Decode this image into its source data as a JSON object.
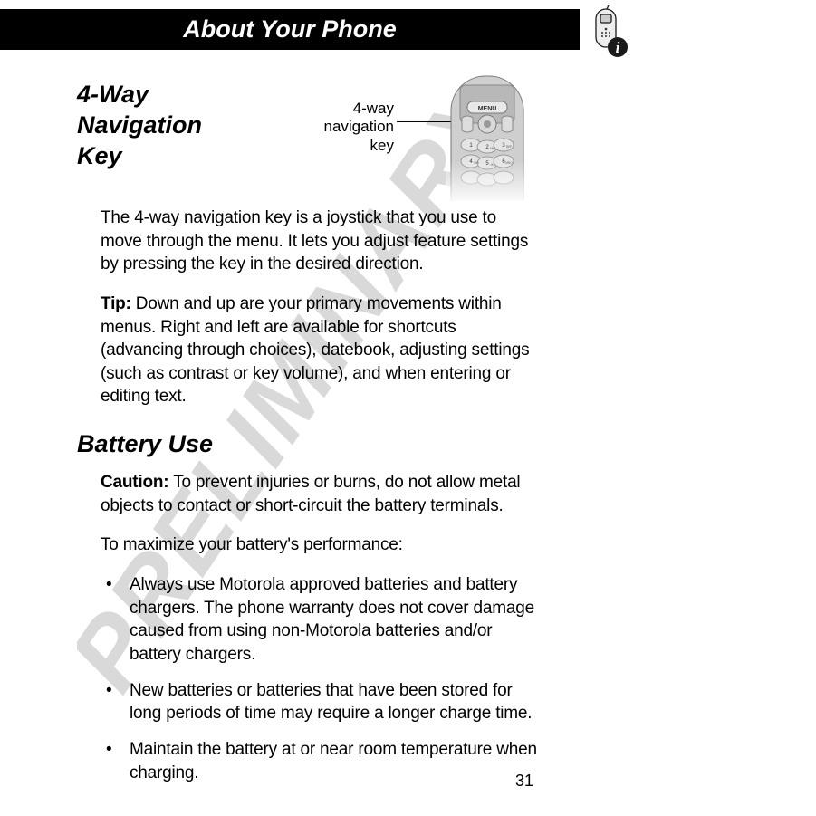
{
  "header": {
    "title": "About Your Phone"
  },
  "section1": {
    "heading": "4-Way Navigation Key",
    "diagram_label_line1": "4-way",
    "diagram_label_line2": "navigation",
    "diagram_label_line3": "key",
    "para1": "The 4-way navigation key is a joystick that you use to move through the menu. It lets you adjust feature settings by pressing the key in the desired direction.",
    "tip_label": "Tip:",
    "tip_text": " Down and up are your primary movements within menus. Right and left are available for shortcuts (advancing through choices), datebook, adjusting settings (such as contrast or key volume), and when entering or editing text."
  },
  "section2": {
    "heading": "Battery Use",
    "caution_label": "Caution:",
    "caution_text": " To prevent injuries or burns, do not allow metal objects to contact or short-circuit the battery terminals.",
    "para2": "To maximize your battery's performance:",
    "bullets": [
      "Always use Motorola approved batteries and battery chargers. The phone warranty does not cover damage caused from using non-Motorola batteries and/or battery chargers.",
      "New batteries or batteries that have been stored for long periods of time may require a longer charge time.",
      "Maintain the battery at or near room temperature when charging."
    ]
  },
  "page_number": "31",
  "watermark_text": "PRELIMINARY"
}
